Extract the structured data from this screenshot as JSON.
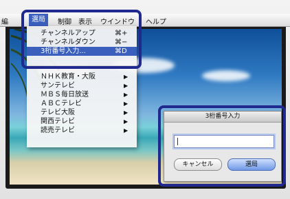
{
  "menubar": {
    "items": [
      {
        "label": "編"
      },
      {
        "label": "選局"
      },
      {
        "label": "制御"
      },
      {
        "label": "表示"
      },
      {
        "label": "ウインドウ"
      },
      {
        "label": "ヘルプ"
      }
    ]
  },
  "menu": {
    "items": [
      {
        "label": "チャンネルアップ",
        "shortcut": "⌘+"
      },
      {
        "label": "チャンネルダウン",
        "shortcut": "⌘−"
      },
      {
        "label": "3桁番号入力...",
        "shortcut": "⌘D"
      }
    ],
    "channels": [
      {
        "label": "ＮＨＫ教育・大阪",
        "arrow": "▶"
      },
      {
        "label": "サンテレビ",
        "arrow": "▶"
      },
      {
        "label": "ＭＢＳ毎日放送",
        "arrow": "▶"
      },
      {
        "label": "ＡＢＣテレビ",
        "arrow": "▶"
      },
      {
        "label": "テレビ大阪",
        "arrow": "▶"
      },
      {
        "label": "関西テレビ",
        "arrow": "▶"
      },
      {
        "label": "読売テレビ",
        "arrow": "▶"
      }
    ]
  },
  "dialog": {
    "title": "3桁番号入力",
    "input_value": "",
    "cancel_label": "キャンセル",
    "ok_label": "選局"
  },
  "colors": {
    "highlight": "#3b5fbd",
    "callout": "#202a8e"
  }
}
